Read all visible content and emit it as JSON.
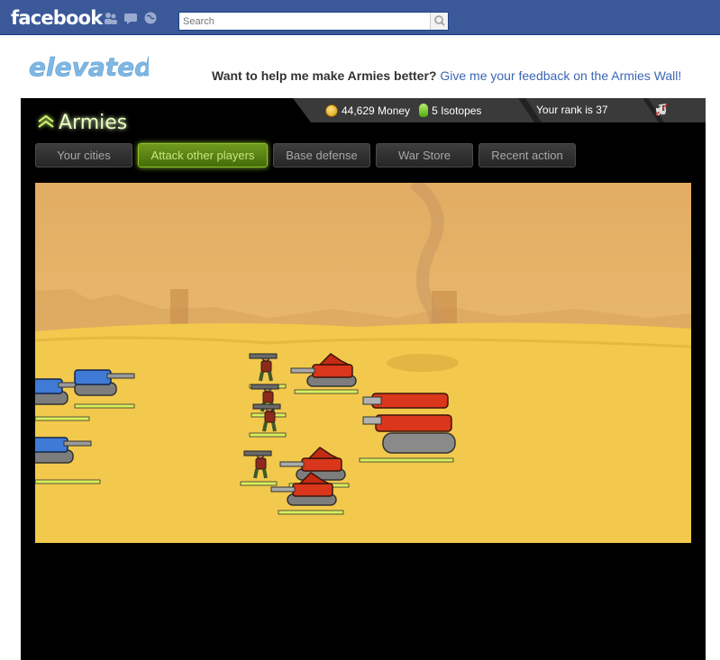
{
  "facebook": {
    "logo_text": "facebook",
    "search_placeholder": "Search",
    "nav_icons": [
      "friends-icon",
      "messages-icon",
      "notifications-globe-icon"
    ]
  },
  "app": {
    "logo_text": "elevated",
    "promo_lead": "Want to help me make Armies better?",
    "promo_link": "Give me your feedback on the Armies Wall!"
  },
  "game": {
    "logo_text": "Armies",
    "status": {
      "money": "44,629 Money",
      "isotopes": "5 Isotopes",
      "rank": "Your rank is 37"
    },
    "tabs": [
      {
        "label": "Your cities",
        "active": false
      },
      {
        "label": "Attack other players",
        "active": true
      },
      {
        "label": "Base defense",
        "active": false
      },
      {
        "label": "War Store",
        "active": false
      },
      {
        "label": "Recent action",
        "active": false
      }
    ],
    "colors": {
      "accent_green": "#8fc42a",
      "desert_sky": "#e8b76a",
      "desert_ground": "#f2c94c",
      "enemy_red": "#d9361c",
      "player_blue": "#3f7ad6"
    }
  }
}
